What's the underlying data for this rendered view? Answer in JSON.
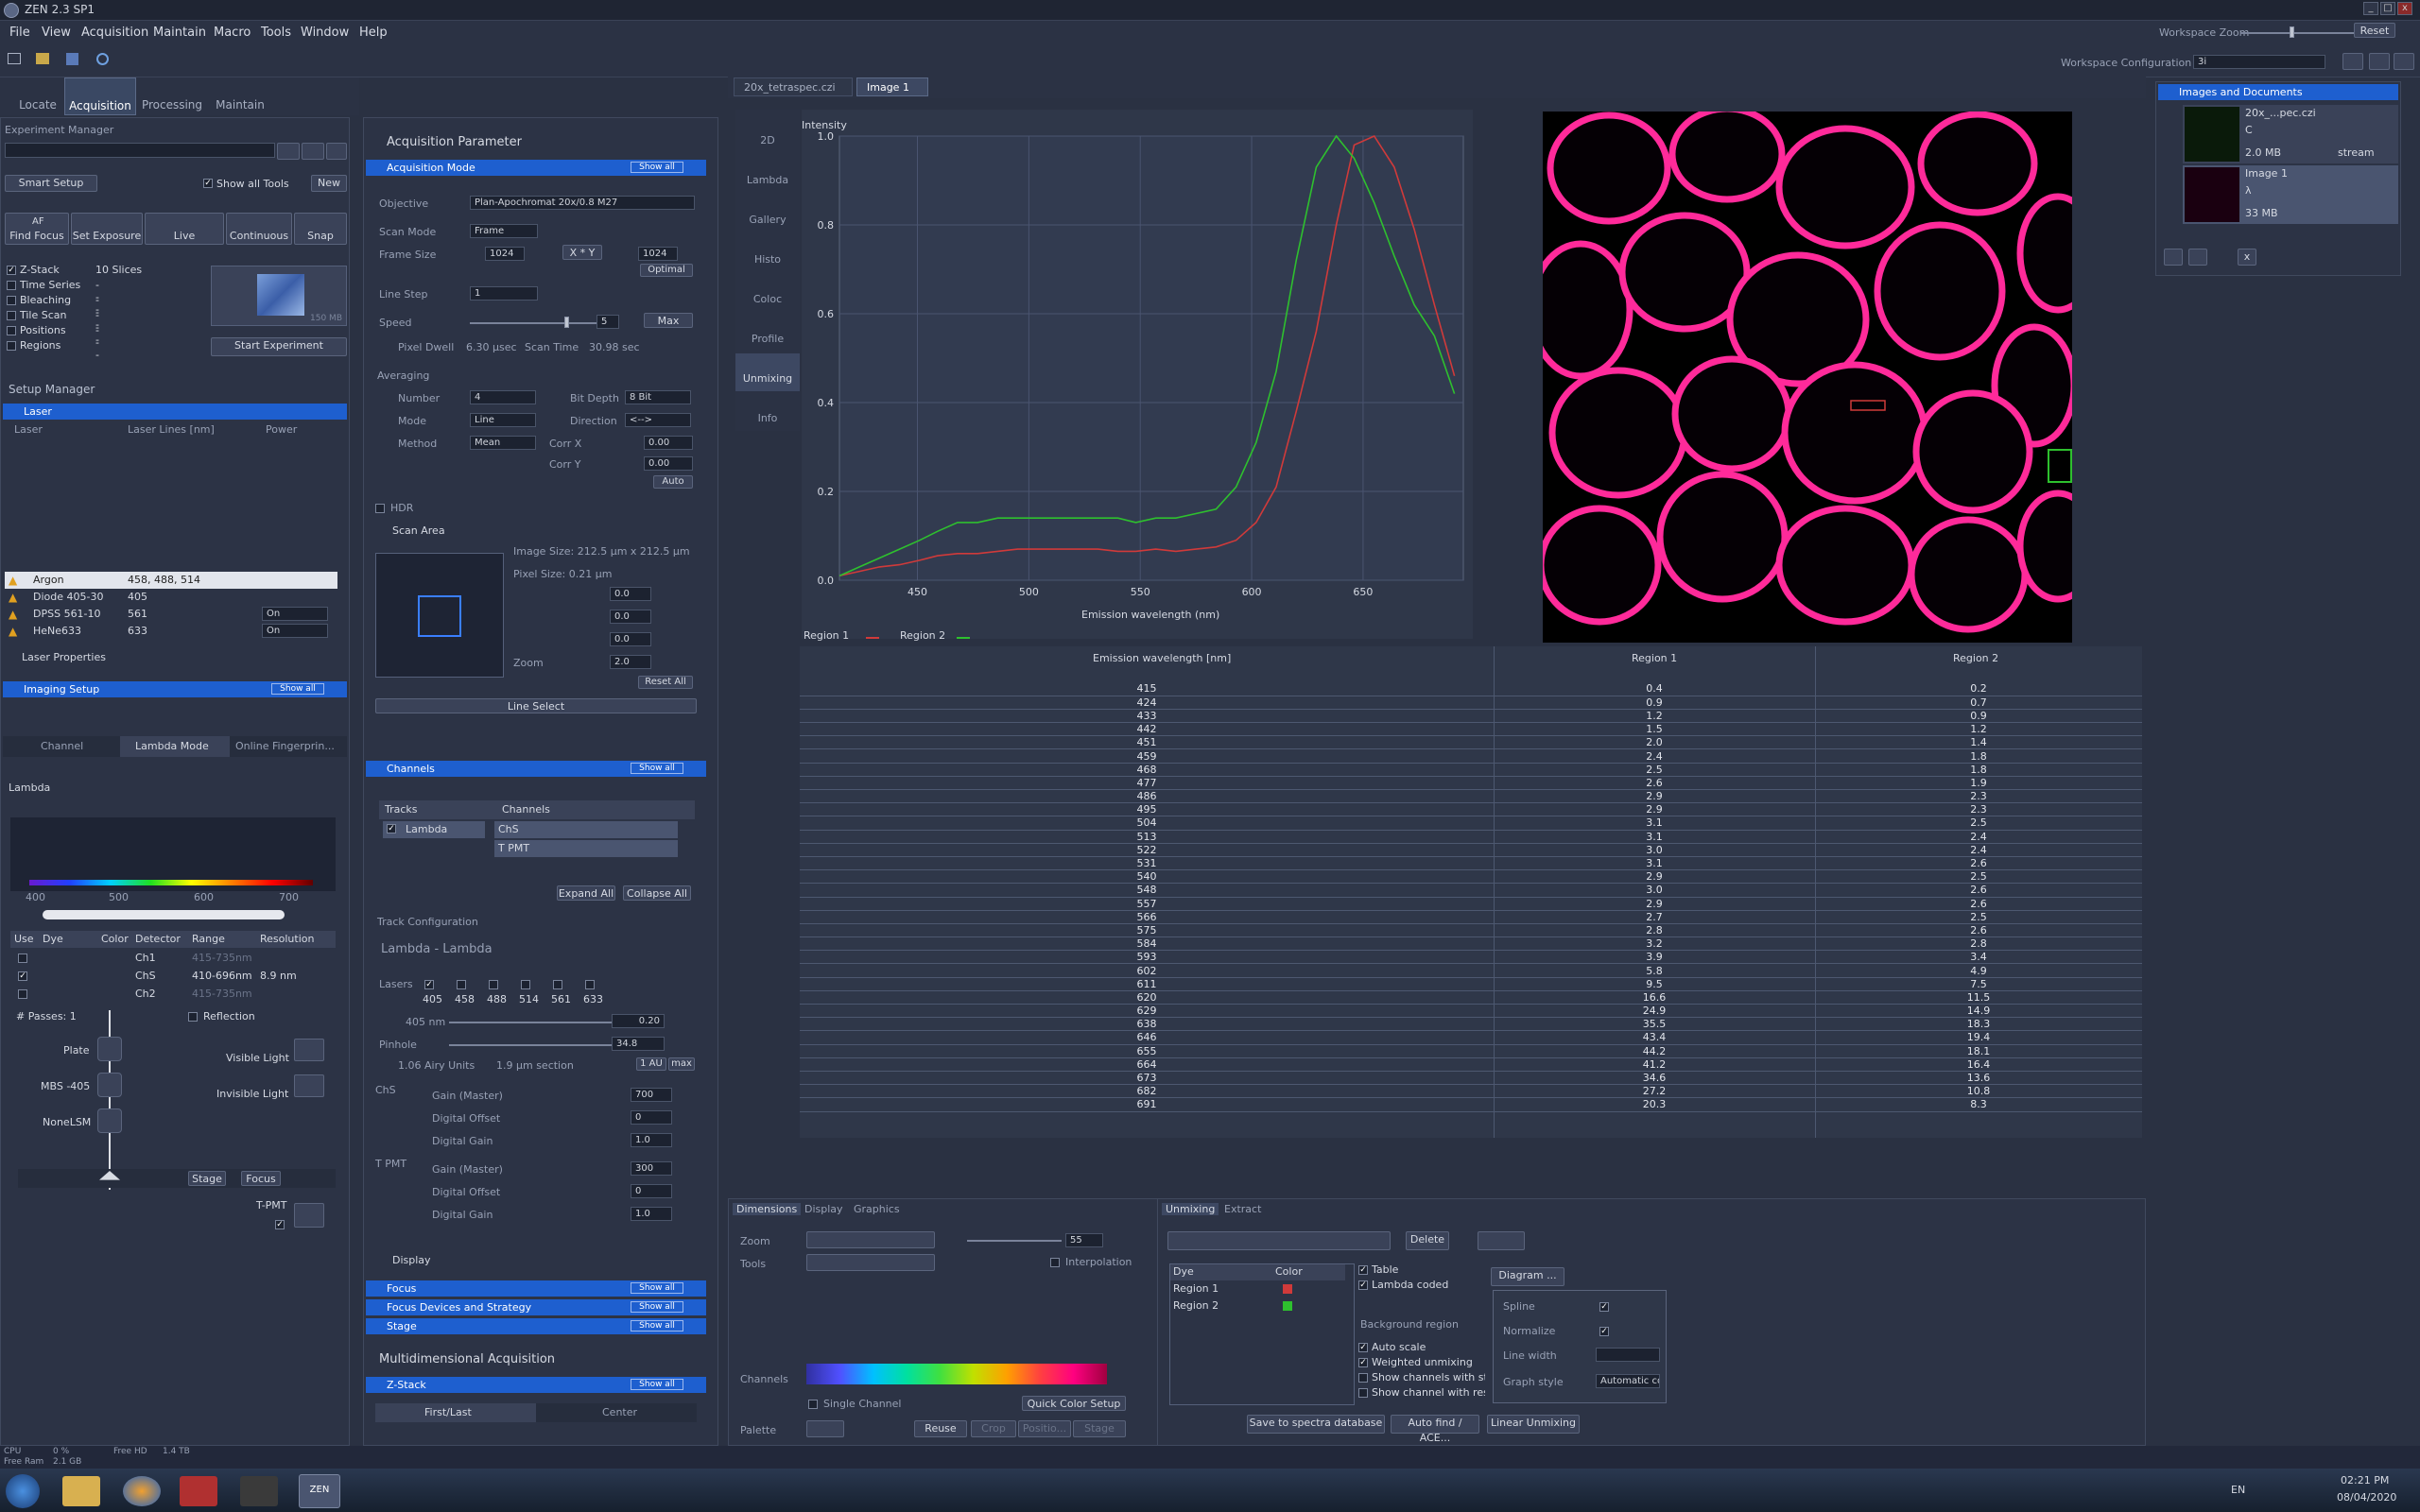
{
  "app": {
    "title": "ZEN 2.3 SP1",
    "window_buttons": [
      "_",
      "□",
      "x"
    ]
  },
  "menu": [
    "File",
    "View",
    "Acquisition",
    "Maintain",
    "Macro",
    "Tools",
    "Window",
    "Help"
  ],
  "workspace": {
    "zoom_label": "Workspace Zoom",
    "reset": "Reset",
    "config_label": "Workspace Configuration",
    "config_value": "3i"
  },
  "main_tabs": [
    "Locate",
    "Acquisition",
    "Processing",
    "Maintain"
  ],
  "experiment": {
    "title": "Experiment Manager",
    "smart_setup": "Smart Setup",
    "show_all_tools": "Show all Tools",
    "new": "New",
    "actions": [
      {
        "top": "AF",
        "label": "Find Focus"
      },
      {
        "top": "",
        "label": "Set Exposure"
      },
      {
        "top": "",
        "label": "Live"
      },
      {
        "top": "",
        "label": "Continuous"
      },
      {
        "top": "",
        "label": "Snap"
      }
    ],
    "dims": [
      {
        "name": "Z-Stack",
        "value": "10 Slices",
        "checked": true
      },
      {
        "name": "Time Series",
        "value": "---"
      },
      {
        "name": "Bleaching",
        "value": "---"
      },
      {
        "name": "Tile Scan",
        "value": "---"
      },
      {
        "name": "Positions",
        "value": "---"
      },
      {
        "name": "Regions",
        "value": "---"
      }
    ],
    "start": "Start Experiment",
    "size": "150 MB"
  },
  "setup": {
    "title": "Setup Manager",
    "laser": "Laser",
    "laser_cols": [
      "Laser",
      "Laser Lines [nm]",
      "Power"
    ],
    "lasers": [
      {
        "name": "Argon",
        "lines": "458, 488, 514",
        "power": ""
      },
      {
        "name": "Diode 405-30",
        "lines": "405",
        "power": ""
      },
      {
        "name": "DPSS 561-10",
        "lines": "561",
        "power": "On"
      },
      {
        "name": "HeNe633",
        "lines": "633",
        "power": "On"
      }
    ],
    "laser_props": "Laser Properties",
    "imaging": "Imaging Setup",
    "show_all": "Show all",
    "imaging_tabs": [
      "Channel",
      "Lambda Mode",
      "Online Fingerprin..."
    ],
    "lambda": "Lambda",
    "spectrum_ticks": [
      "400",
      "500",
      "600",
      "700"
    ],
    "det_cols": [
      "Use",
      "Dye",
      "Color",
      "Detector",
      "Range",
      "Resolution"
    ],
    "detectors": [
      {
        "name": "Ch1",
        "range": "415-735nm",
        "res": ""
      },
      {
        "name": "ChS",
        "range": "410-696nm",
        "res": "8.9  nm"
      },
      {
        "name": "Ch2",
        "range": "415-735nm",
        "res": ""
      }
    ],
    "passes": "# Passes: 1",
    "reflection": "Reflection",
    "plate": "Plate",
    "visible_light": "Visible Light",
    "invisible_light": "Invisible Light",
    "mbs": "MBS -405",
    "nonelsm": "NoneLSM",
    "stage": "Stage",
    "focus": "Focus",
    "tpmt": "T-PMT"
  },
  "acq": {
    "title": "Acquisition Parameter",
    "mode": "Acquisition Mode",
    "show_all": "Show all",
    "objective_label": "Objective",
    "objective": "Plan-Apochromat 20x/0.8 M27",
    "scan_mode_label": "Scan Mode",
    "scan_mode": "Frame",
    "frame_size_label": "Frame Size",
    "x": "1024",
    "xy": "X * Y",
    "y": "1024",
    "optimal": "Optimal",
    "line_step_label": "Line Step",
    "line_step": "1",
    "speed_label": "Speed",
    "speed": "5",
    "max": "Max",
    "pixel_dwell": "Pixel Dwell",
    "pixel_dwell_v": "6.30 µsec",
    "scan_time": "Scan Time",
    "scan_time_v": "30.98 sec",
    "averaging": "Averaging",
    "number_label": "Number",
    "number": "4",
    "bitdepth_label": "Bit Depth",
    "bitdepth": "8 Bit",
    "mode_label": "Mode",
    "mode_v": "Line",
    "direction_label": "Direction",
    "direction": "<-->",
    "method_label": "Method",
    "method": "Mean",
    "corrx": "Corr X",
    "corry": "Corr Y",
    "corr_v": "0.00",
    "auto": "Auto",
    "hdr": "HDR",
    "scan_area": "Scan Area",
    "image_size": "Image Size:  212.5 µm x 212.5 µm",
    "pixel_size": "Pixel Size:   0.21 µm",
    "scan_vals": [
      "0.0",
      "0.0",
      "0.0"
    ],
    "zoom_label": "Zoom",
    "zoom": "2.0",
    "reset_all": "Reset All",
    "line_select": "Line Select",
    "channels": "Channels",
    "tracks": "Tracks",
    "channels_col": "Channels",
    "track": "Lambda",
    "ch1": "ChS",
    "ch2": "T PMT",
    "expand": "Expand All",
    "collapse": "Collapse All",
    "track_cfg": "Track Configuration",
    "track_name": "Lambda - Lambda",
    "lasers_label": "Lasers",
    "laser_lines": [
      "405",
      "458",
      "488",
      "514",
      "561",
      "633"
    ],
    "l405": "405 nm",
    "l405_v": "0.20",
    "pinhole": "Pinhole",
    "pinhole_v": "34.8",
    "airy": "1.06 Airy Units",
    "section": "1.9 µm section",
    "au": "1 AU",
    "pmax": "max",
    "chs": "ChS",
    "gain": "Gain (Master)",
    "gain_v": "700",
    "offset": "Digital Offset",
    "offset_v": "0",
    "dgain": "Digital Gain",
    "dgain_v": "1.0",
    "tpmt": "T PMT",
    "gain2_v": "300",
    "display": "Display",
    "focus": "Focus",
    "focus_dev": "Focus Devices and Strategy",
    "stage": "Stage",
    "multi": "Multidimensional Acquisition",
    "zstack": "Z-Stack",
    "first_last": "First/Last",
    "center": "Center"
  },
  "doc_tabs": [
    "20x_tetraspec.czi",
    "Image 1"
  ],
  "view_tabs": [
    "2D",
    "Lambda",
    "Gallery",
    "Histo",
    "Coloc",
    "Profile",
    "Unmixing",
    "Info"
  ],
  "chart_data": {
    "type": "line",
    "ylabel": "Intensity",
    "xlabel": "Emission wavelength (nm)",
    "xlim": [
      415,
      695
    ],
    "ylim": [
      0,
      1
    ],
    "xticks": [
      "450",
      "500",
      "550",
      "600",
      "650"
    ],
    "yticks": [
      "0.0",
      "0.2",
      "0.4",
      "0.6",
      "0.8",
      "1.0"
    ],
    "x": [
      415,
      424,
      433,
      442,
      451,
      459,
      468,
      477,
      486,
      495,
      504,
      513,
      522,
      531,
      540,
      548,
      557,
      566,
      575,
      584,
      593,
      602,
      611,
      620,
      629,
      638,
      646,
      655,
      664,
      673,
      682,
      691
    ],
    "series": [
      {
        "name": "Region 1",
        "color": "#d03a3a",
        "values": [
          0.01,
          0.02,
          0.03,
          0.035,
          0.045,
          0.055,
          0.06,
          0.06,
          0.065,
          0.07,
          0.07,
          0.07,
          0.07,
          0.07,
          0.065,
          0.065,
          0.07,
          0.065,
          0.07,
          0.075,
          0.09,
          0.13,
          0.21,
          0.38,
          0.56,
          0.8,
          0.98,
          1.0,
          0.93,
          0.79,
          0.62,
          0.46
        ]
      },
      {
        "name": "Region 2",
        "color": "#2ec02e",
        "values": [
          0.01,
          0.03,
          0.05,
          0.07,
          0.09,
          0.11,
          0.13,
          0.13,
          0.14,
          0.14,
          0.14,
          0.14,
          0.14,
          0.14,
          0.14,
          0.13,
          0.14,
          0.14,
          0.15,
          0.16,
          0.21,
          0.31,
          0.47,
          0.72,
          0.93,
          1.0,
          0.95,
          0.85,
          0.73,
          0.62,
          0.55,
          0.42
        ]
      }
    ]
  },
  "table": {
    "cols": [
      "Emission wavelength [nm]",
      "Region 1",
      "Region 2"
    ],
    "rows": [
      [
        "415",
        "0.4",
        "0.2"
      ],
      [
        "424",
        "0.9",
        "0.7"
      ],
      [
        "433",
        "1.2",
        "0.9"
      ],
      [
        "442",
        "1.5",
        "1.2"
      ],
      [
        "451",
        "2.0",
        "1.4"
      ],
      [
        "459",
        "2.4",
        "1.8"
      ],
      [
        "468",
        "2.5",
        "1.8"
      ],
      [
        "477",
        "2.6",
        "1.9"
      ],
      [
        "486",
        "2.9",
        "2.3"
      ],
      [
        "495",
        "2.9",
        "2.3"
      ],
      [
        "504",
        "3.1",
        "2.5"
      ],
      [
        "513",
        "3.1",
        "2.4"
      ],
      [
        "522",
        "3.0",
        "2.4"
      ],
      [
        "531",
        "3.1",
        "2.6"
      ],
      [
        "540",
        "2.9",
        "2.5"
      ],
      [
        "548",
        "3.0",
        "2.6"
      ],
      [
        "557",
        "2.9",
        "2.6"
      ],
      [
        "566",
        "2.7",
        "2.5"
      ],
      [
        "575",
        "2.8",
        "2.6"
      ],
      [
        "584",
        "3.2",
        "2.8"
      ],
      [
        "593",
        "3.9",
        "3.4"
      ],
      [
        "602",
        "5.8",
        "4.9"
      ],
      [
        "611",
        "9.5",
        "7.5"
      ],
      [
        "620",
        "16.6",
        "11.5"
      ],
      [
        "629",
        "24.9",
        "14.9"
      ],
      [
        "638",
        "35.5",
        "18.3"
      ],
      [
        "646",
        "43.4",
        "19.4"
      ],
      [
        "655",
        "44.2",
        "18.1"
      ],
      [
        "664",
        "41.2",
        "16.4"
      ],
      [
        "673",
        "34.6",
        "13.6"
      ],
      [
        "682",
        "27.2",
        "10.8"
      ],
      [
        "691",
        "20.3",
        "8.3"
      ]
    ]
  },
  "bottom": {
    "tabs": [
      "Dimensions",
      "Display",
      "Graphics"
    ],
    "zoom": "Zoom",
    "zoom_v": "55",
    "tools": "Tools",
    "interp": "Interpolation",
    "channels": "Channels",
    "single": "Single Channel",
    "quick_color": "Quick Color Setup",
    "palette": "Palette",
    "reuse": "Reuse",
    "crop": "Crop",
    "position": "Positio...",
    "stagebtn": "Stage",
    "unmix_tabs": [
      "Unmixing",
      "Extract"
    ],
    "delete": "Delete",
    "dye_col": "Dye",
    "color_col": "Color",
    "regions": [
      "Region 1",
      "Region 2"
    ],
    "region_colors": [
      "#d03a3a",
      "#2ec02e"
    ],
    "table_chk": "Table",
    "lambda_coded": "Lambda coded",
    "diagram": "Diagram ...",
    "bg_region": "Background region",
    "auto_scale": "Auto scale",
    "weighted": "Weighted unmixing",
    "show_stat": "Show channels with stat",
    "show_resid": "Show channel with resid",
    "spline": "Spline",
    "normalize": "Normalize",
    "line_width": "Line width",
    "graph_style": "Graph style",
    "graph_style_v": "Automatic colored",
    "save_spectra": "Save to spectra database",
    "auto_find": "Auto find / ACE...",
    "linear": "Linear Unmixing"
  },
  "images_docs": {
    "title": "Images and Documents",
    "items": [
      {
        "name": "20x_...pec.czi",
        "size": "2.0 MB",
        "extra": "stream",
        "ch": "C"
      },
      {
        "name": "Image 1",
        "size": "33 MB",
        "extra": "",
        "ch": "λ"
      }
    ]
  },
  "status": {
    "cpu": "CPU",
    "cpu_v": "0 %",
    "free_hd": "Free HD",
    "free_hd_v": "1.4 TB",
    "free_ram": "Free Ram",
    "free_ram_v": "2.1 GB"
  },
  "taskbar": {
    "lang": "EN",
    "time": "02:21 PM",
    "date": "08/04/2020",
    "app": "ZEN"
  }
}
